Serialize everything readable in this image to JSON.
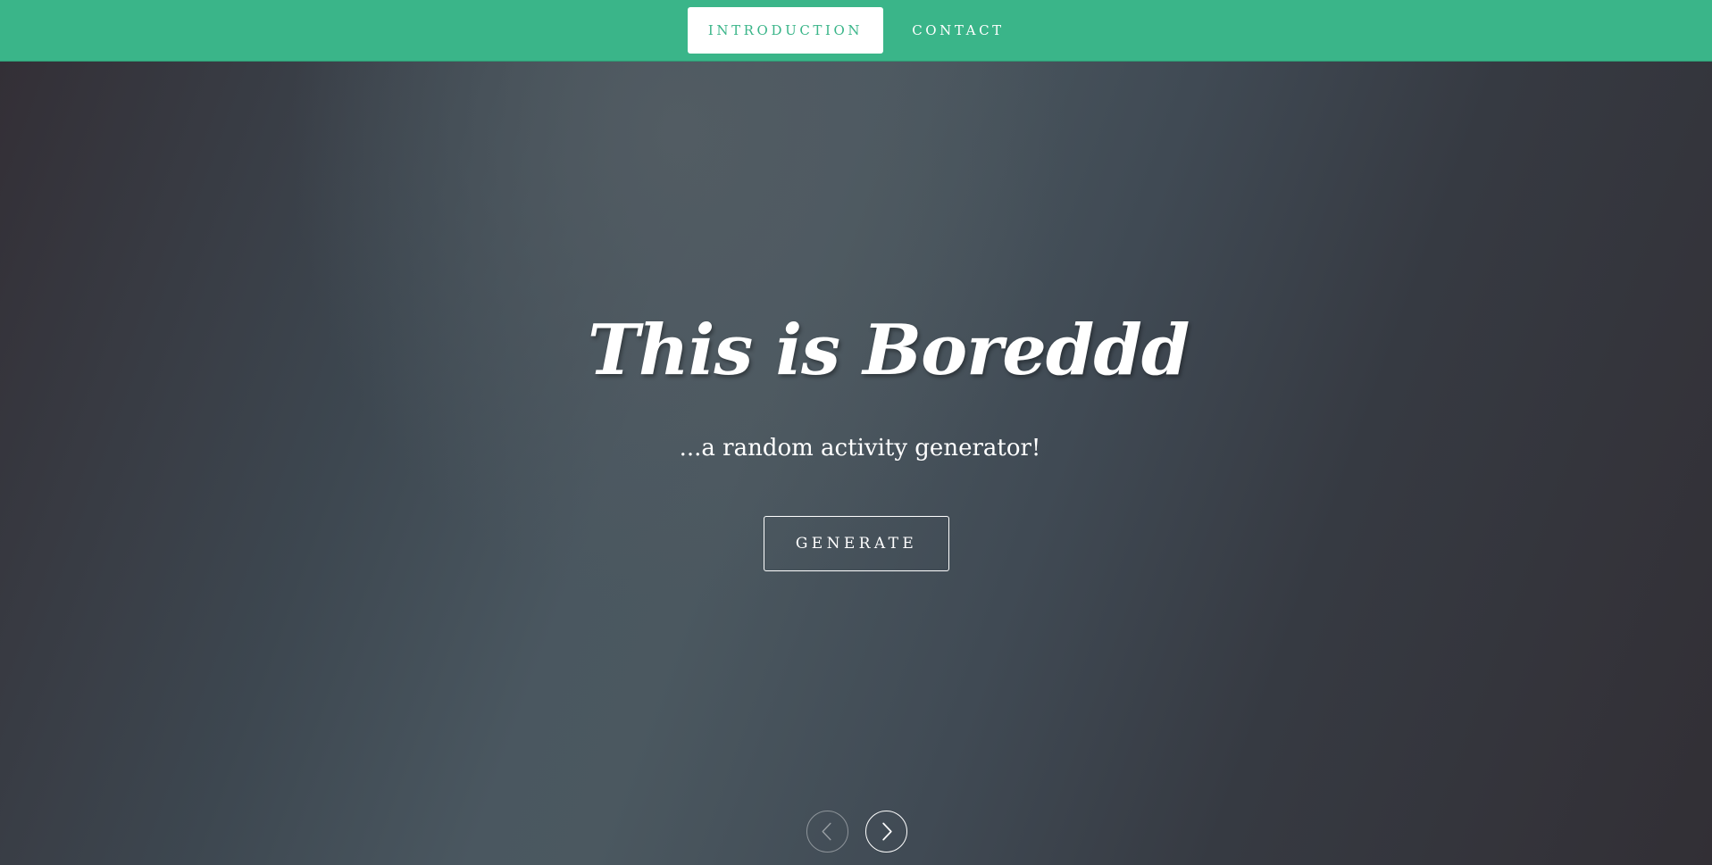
{
  "nav": {
    "items": [
      {
        "label": "INTRODUCTION",
        "active": true
      },
      {
        "label": "CONTACT",
        "active": false
      }
    ]
  },
  "hero": {
    "title": "This is Boreddd",
    "subtitle": "...a random activity generator!",
    "generate_label": "GENERATE"
  },
  "carousel": {
    "prev_icon": "chevron-left-icon",
    "next_icon": "chevron-right-icon"
  },
  "colors": {
    "nav_background": "#3ab589",
    "nav_active_text": "#3ab589",
    "hero_text": "#ffffff"
  }
}
